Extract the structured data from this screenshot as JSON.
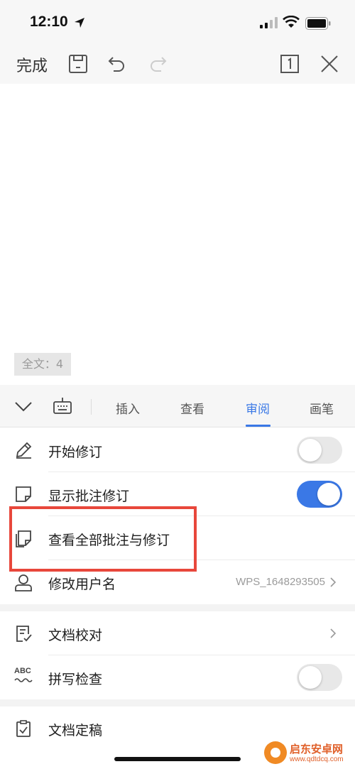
{
  "status_bar": {
    "time": "12:10"
  },
  "toolbar": {
    "done_label": "完成"
  },
  "document": {
    "word_count": "全文：4"
  },
  "tabs": [
    {
      "label": "插入",
      "active": false
    },
    {
      "label": "查看",
      "active": false
    },
    {
      "label": "审阅",
      "active": true
    },
    {
      "label": "画笔",
      "active": false
    }
  ],
  "review_items": [
    {
      "label": "开始修订",
      "icon": "pencil-icon",
      "toggle": "off"
    },
    {
      "label": "显示批注修订",
      "icon": "note-icon",
      "toggle": "on"
    },
    {
      "label": "查看全部批注与修订",
      "icon": "notes-stack-icon"
    },
    {
      "label": "修改用户名",
      "icon": "user-icon",
      "value": "WPS_1648293505"
    },
    {
      "label": "文档校对",
      "icon": "doc-check-icon"
    },
    {
      "label": "拼写检查",
      "icon": "abc-spell-icon",
      "icon_text": "ABC",
      "toggle": "off"
    },
    {
      "label": "文档定稿",
      "icon": "doc-final-icon"
    }
  ],
  "watermark": {
    "name": "启东安卓网",
    "url": "www.qdtdcq.com"
  },
  "colors": {
    "accent": "#3a78e6",
    "highlight": "#e8473b"
  }
}
